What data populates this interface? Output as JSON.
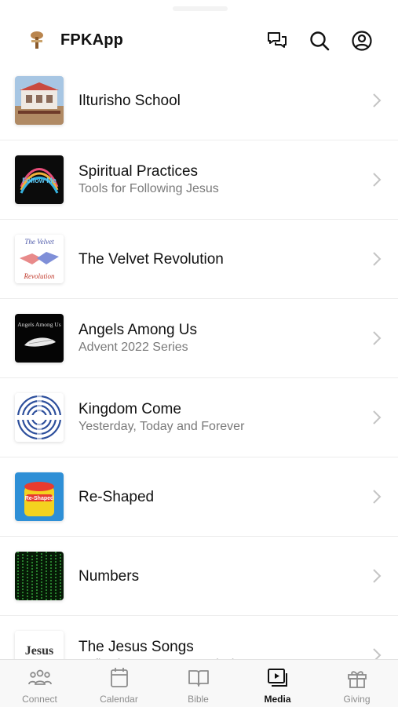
{
  "app": {
    "title": "FPKApp"
  },
  "header": {
    "icons": [
      "chat-icon",
      "search-icon",
      "account-icon"
    ]
  },
  "media_items": [
    {
      "title": "Ilturisho School",
      "subtitle": ""
    },
    {
      "title": "Spiritual Practices",
      "subtitle": "Tools for Following Jesus"
    },
    {
      "title": "The Velvet Revolution",
      "subtitle": ""
    },
    {
      "title": "Angels Among Us",
      "subtitle": "Advent 2022 Series"
    },
    {
      "title": "Kingdom Come",
      "subtitle": "Yesterday, Today and Forever"
    },
    {
      "title": "Re-Shaped",
      "subtitle": ""
    },
    {
      "title": "Numbers",
      "subtitle": ""
    },
    {
      "title": "The Jesus Songs",
      "subtitle": "Reflections on Jesus and what Jesus means"
    }
  ],
  "thumb_text": {
    "follow_me": "Follow Me",
    "velvet_top": "The Velvet",
    "velvet_bottom": "Revolution",
    "angels": "Angels Among Us",
    "reshaped": "Re-Shaped",
    "jesus_songs": "Jesus Songs"
  },
  "tabs": [
    {
      "label": "Connect",
      "icon": "people-icon",
      "active": false
    },
    {
      "label": "Calendar",
      "icon": "calendar-icon",
      "active": false
    },
    {
      "label": "Bible",
      "icon": "book-icon",
      "active": false
    },
    {
      "label": "Media",
      "icon": "media-icon",
      "active": true
    },
    {
      "label": "Giving",
      "icon": "gift-icon",
      "active": false
    }
  ],
  "colors": {
    "active_tab": "#111111",
    "inactive_tab": "#8c8c8c",
    "subtitle": "#7a7a7a"
  }
}
